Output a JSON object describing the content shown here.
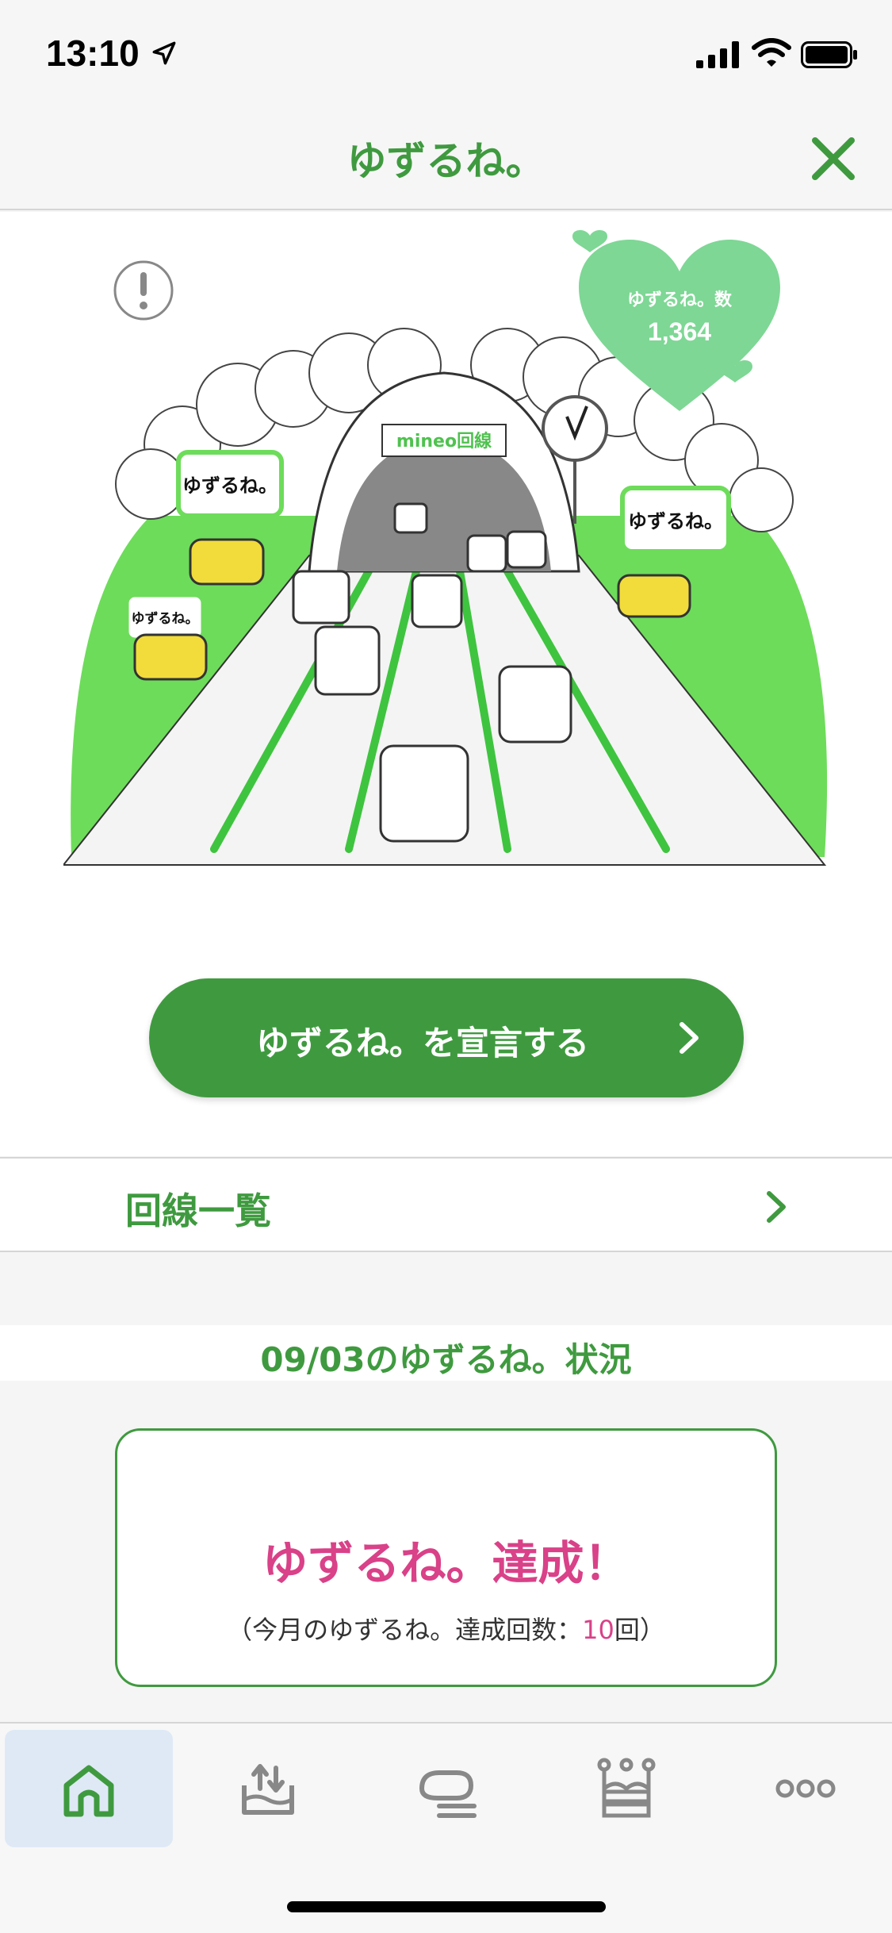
{
  "status_bar": {
    "time": "13:10",
    "icons": [
      "location-arrow-icon",
      "cellular-signal-icon",
      "wifi-icon",
      "battery-icon"
    ]
  },
  "header": {
    "title": "ゆずるね。",
    "close_icon": "close-icon"
  },
  "hero": {
    "heart_badge": {
      "label": "ゆずるね。数",
      "value": "1,364"
    },
    "illustration_texts": {
      "tunnel_sign": "mineo回線",
      "bubble": "ゆずるね。"
    }
  },
  "declare_button": {
    "label": "ゆずるね。を宣言する"
  },
  "line_list": {
    "label": "回線一覧"
  },
  "status_section": {
    "date_title": "09/03のゆずるね。状況",
    "result_title": "ゆずるね。達成！",
    "result_sub_prefix": "（今月のゆずるね。達成回数：",
    "result_count": "10",
    "result_sub_suffix": "回）"
  },
  "tab_bar": {
    "tabs": [
      {
        "icon": "home-icon",
        "active": true
      },
      {
        "icon": "upload-tray-icon",
        "active": false
      },
      {
        "icon": "chat-bubble-icon",
        "active": false
      },
      {
        "icon": "crown-icon",
        "active": false
      },
      {
        "icon": "more-icon",
        "active": false
      }
    ]
  },
  "colors": {
    "brand_green": "#3f9a3f",
    "accent_pink": "#d94188",
    "light_green": "#6ddc5a",
    "heart_green": "#7ed795"
  }
}
